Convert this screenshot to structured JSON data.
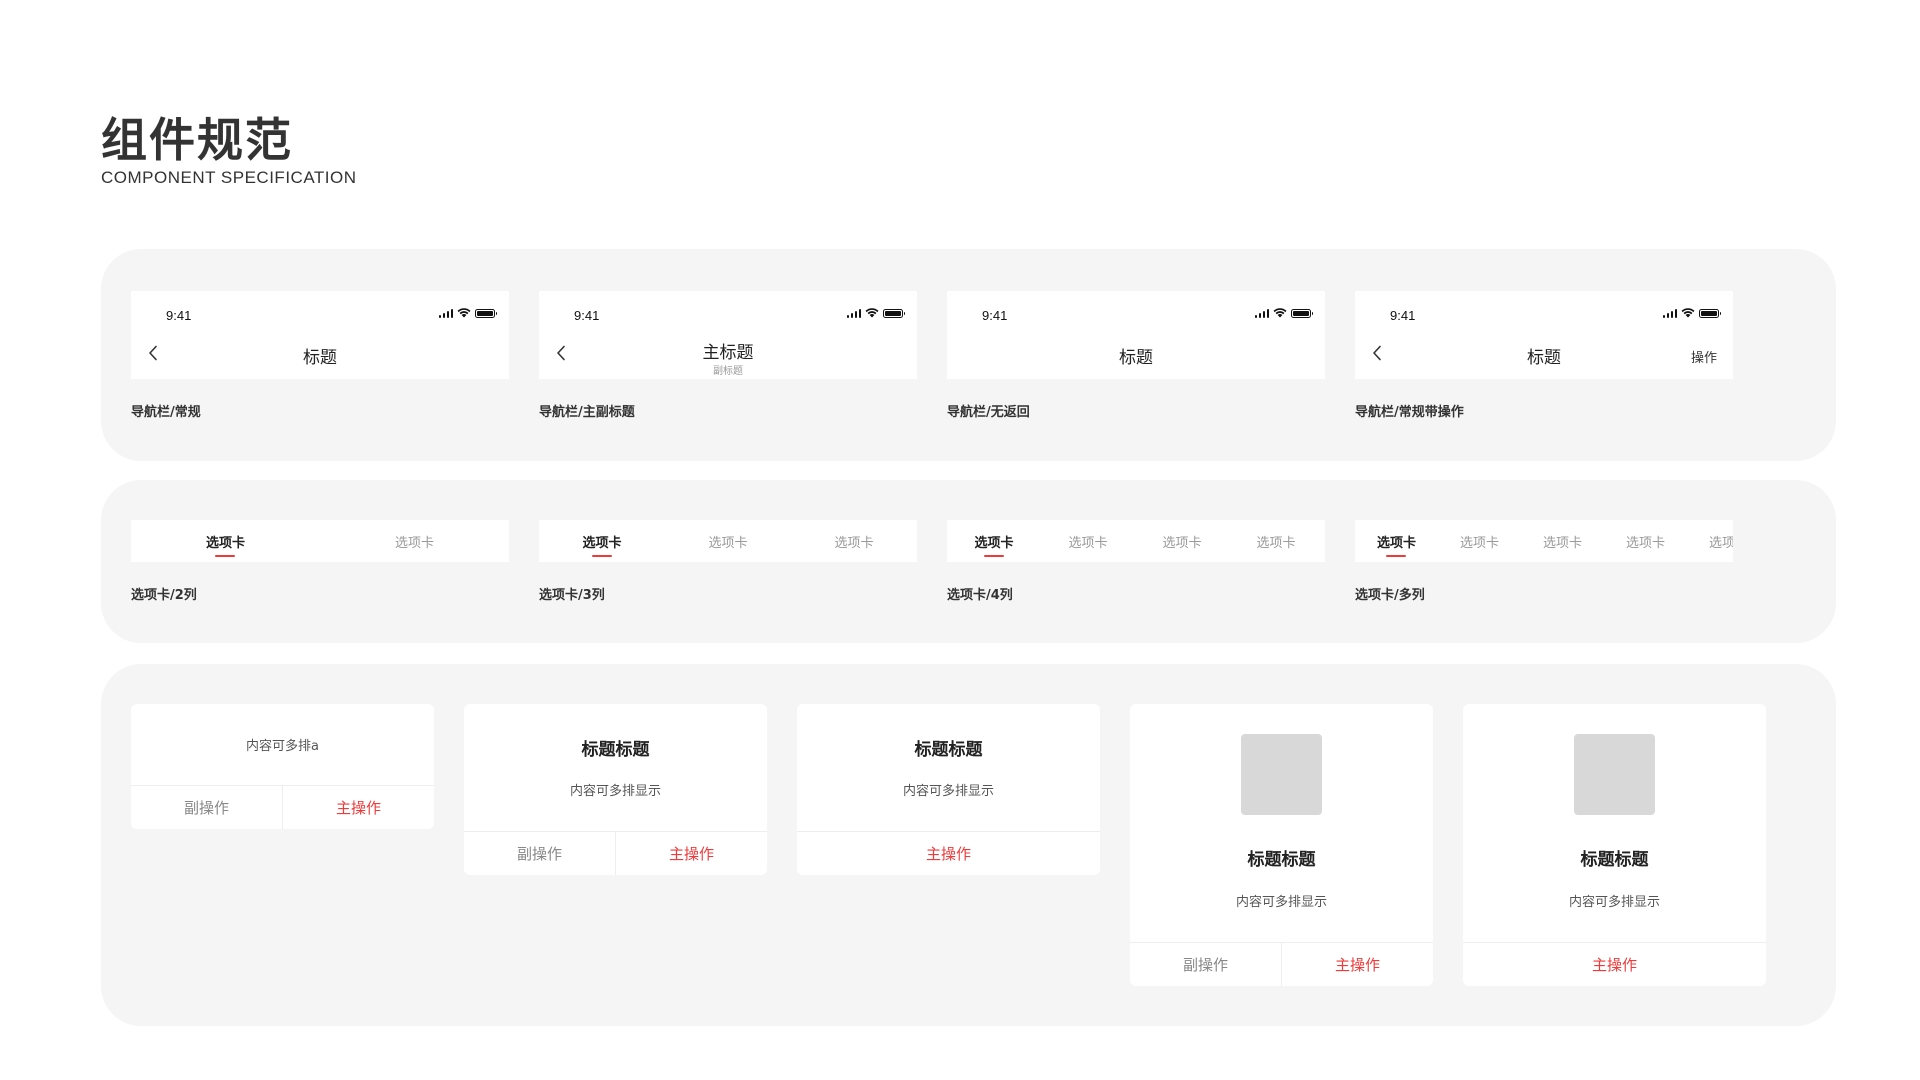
{
  "header": {
    "title": "组件规范",
    "subtitle": "COMPONENT SPECIFICATION"
  },
  "colors": {
    "accent": "#ee3a3a",
    "panel_bg": "#f5f5f5",
    "placeholder": "#d8d8d8"
  },
  "navbars": {
    "time": "9:41",
    "items": [
      {
        "title": "标题",
        "caption": "导航栏/常规",
        "has_back": true
      },
      {
        "title": "主标题",
        "subtitle": "副标题",
        "caption": "导航栏/主副标题",
        "has_back": true
      },
      {
        "title": "标题",
        "caption": "导航栏/无返回",
        "has_back": false
      },
      {
        "title": "标题",
        "action": "操作",
        "caption": "导航栏/常规带操作",
        "has_back": true
      }
    ]
  },
  "tabs": {
    "label": "选项卡",
    "groups": [
      {
        "caption": "选项卡/2列",
        "count": 2
      },
      {
        "caption": "选项卡/3列",
        "count": 3
      },
      {
        "caption": "选项卡/4列",
        "count": 4
      },
      {
        "caption": "选项卡/多列",
        "count": 5
      }
    ]
  },
  "dialogs": {
    "title": "标题标题",
    "content": "内容可多排显示",
    "content_short": "内容可多排a",
    "secondary": "副操作",
    "primary": "主操作"
  }
}
